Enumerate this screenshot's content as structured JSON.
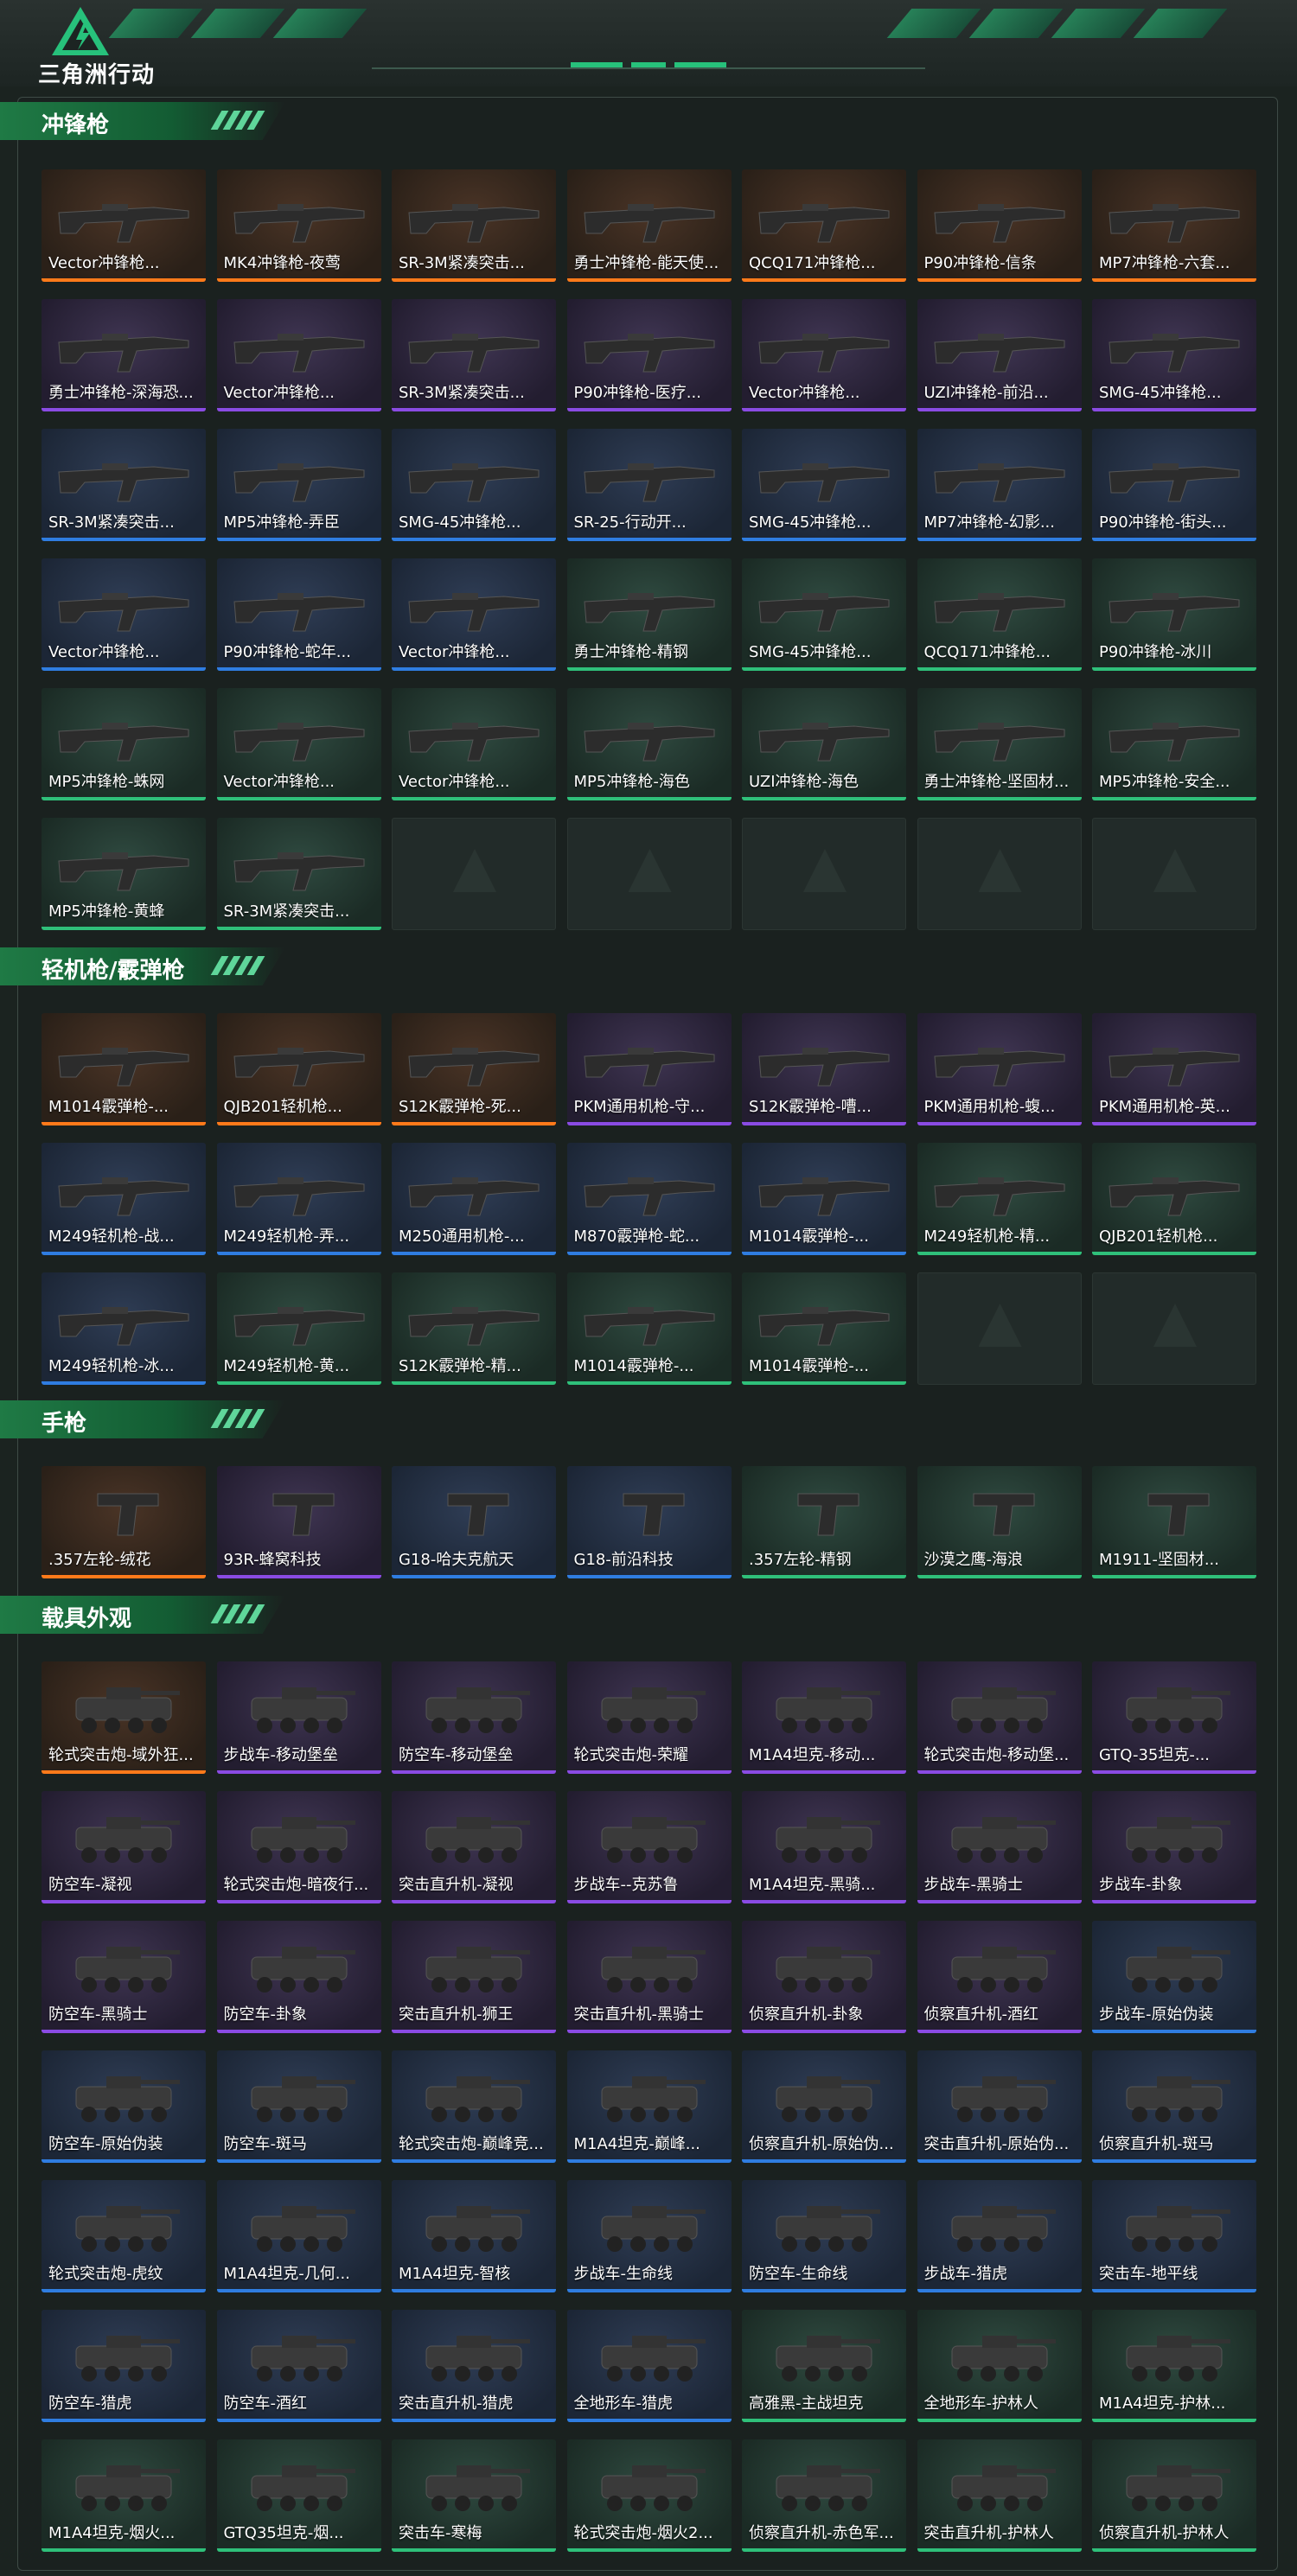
{
  "brand": {
    "name": "三角洲行动"
  },
  "colors": {
    "orange": "#ff7a1a",
    "purple": "#8a4be3",
    "blue": "#2f7de1",
    "green": "#2fc07a",
    "accent": "#27c17b"
  },
  "sections": [
    {
      "title": "冲锋枪",
      "kind": "gun",
      "items": [
        {
          "label": "Vector冲锋枪...",
          "rarity": "orange"
        },
        {
          "label": "MK4冲锋枪-夜莺",
          "rarity": "orange"
        },
        {
          "label": "SR-3M紧凑突击...",
          "rarity": "orange"
        },
        {
          "label": "勇士冲锋枪-能天使...",
          "rarity": "orange"
        },
        {
          "label": "QCQ171冲锋枪...",
          "rarity": "orange"
        },
        {
          "label": "P90冲锋枪-信条",
          "rarity": "orange"
        },
        {
          "label": "MP7冲锋枪-六套...",
          "rarity": "orange"
        },
        {
          "label": "勇士冲锋枪-深海恐...",
          "rarity": "purple"
        },
        {
          "label": "Vector冲锋枪...",
          "rarity": "purple"
        },
        {
          "label": "SR-3M紧凑突击...",
          "rarity": "purple"
        },
        {
          "label": "P90冲锋枪-医疗...",
          "rarity": "purple"
        },
        {
          "label": "Vector冲锋枪...",
          "rarity": "purple"
        },
        {
          "label": "UZI冲锋枪-前沿...",
          "rarity": "purple"
        },
        {
          "label": "SMG-45冲锋枪...",
          "rarity": "purple"
        },
        {
          "label": "SR-3M紧凑突击...",
          "rarity": "blue"
        },
        {
          "label": "MP5冲锋枪-弄臣",
          "rarity": "blue"
        },
        {
          "label": "SMG-45冲锋枪...",
          "rarity": "blue"
        },
        {
          "label": "SR-25-行动开...",
          "rarity": "blue"
        },
        {
          "label": "SMG-45冲锋枪...",
          "rarity": "blue"
        },
        {
          "label": "MP7冲锋枪-幻影...",
          "rarity": "blue"
        },
        {
          "label": "P90冲锋枪-街头...",
          "rarity": "blue"
        },
        {
          "label": "Vector冲锋枪...",
          "rarity": "blue"
        },
        {
          "label": "P90冲锋枪-蛇年...",
          "rarity": "blue"
        },
        {
          "label": "Vector冲锋枪...",
          "rarity": "blue"
        },
        {
          "label": "勇士冲锋枪-精钢",
          "rarity": "green"
        },
        {
          "label": "SMG-45冲锋枪...",
          "rarity": "green"
        },
        {
          "label": "QCQ171冲锋枪...",
          "rarity": "green"
        },
        {
          "label": "P90冲锋枪-冰川",
          "rarity": "green"
        },
        {
          "label": "MP5冲锋枪-蛛网",
          "rarity": "green"
        },
        {
          "label": "Vector冲锋枪...",
          "rarity": "green"
        },
        {
          "label": "Vector冲锋枪...",
          "rarity": "green"
        },
        {
          "label": "MP5冲锋枪-海色",
          "rarity": "green"
        },
        {
          "label": "UZI冲锋枪-海色",
          "rarity": "green"
        },
        {
          "label": "勇士冲锋枪-坚固材...",
          "rarity": "green"
        },
        {
          "label": "MP5冲锋枪-安全...",
          "rarity": "green"
        },
        {
          "label": "MP5冲锋枪-黄蜂",
          "rarity": "green"
        },
        {
          "label": "SR-3M紧凑突击...",
          "rarity": "green"
        },
        {
          "label": "",
          "rarity": "empty"
        },
        {
          "label": "",
          "rarity": "empty"
        },
        {
          "label": "",
          "rarity": "empty"
        },
        {
          "label": "",
          "rarity": "empty"
        },
        {
          "label": "",
          "rarity": "empty"
        }
      ]
    },
    {
      "title": "轻机枪/霰弹枪",
      "kind": "gun",
      "items": [
        {
          "label": "M1014霰弹枪-...",
          "rarity": "orange"
        },
        {
          "label": "QJB201轻机枪...",
          "rarity": "orange"
        },
        {
          "label": "S12K霰弹枪-死...",
          "rarity": "orange"
        },
        {
          "label": "PKM通用机枪-守...",
          "rarity": "purple"
        },
        {
          "label": "S12K霰弹枪-嘈...",
          "rarity": "purple"
        },
        {
          "label": "PKM通用机枪-蝮...",
          "rarity": "purple"
        },
        {
          "label": "PKM通用机枪-英...",
          "rarity": "purple"
        },
        {
          "label": "M249轻机枪-战...",
          "rarity": "blue"
        },
        {
          "label": "M249轻机枪-弄...",
          "rarity": "blue"
        },
        {
          "label": "M250通用机枪-...",
          "rarity": "blue"
        },
        {
          "label": "M870霰弹枪-蛇...",
          "rarity": "blue"
        },
        {
          "label": "M1014霰弹枪-...",
          "rarity": "blue"
        },
        {
          "label": "M249轻机枪-精...",
          "rarity": "green"
        },
        {
          "label": "QJB201轻机枪...",
          "rarity": "green"
        },
        {
          "label": "M249轻机枪-冰...",
          "rarity": "blue"
        },
        {
          "label": "M249轻机枪-黄...",
          "rarity": "green"
        },
        {
          "label": "S12K霰弹枪-精...",
          "rarity": "green"
        },
        {
          "label": "M1014霰弹枪-...",
          "rarity": "green"
        },
        {
          "label": "M1014霰弹枪-...",
          "rarity": "green"
        },
        {
          "label": "",
          "rarity": "empty"
        },
        {
          "label": "",
          "rarity": "empty"
        }
      ]
    },
    {
      "title": "手枪",
      "kind": "pistol",
      "items": [
        {
          "label": ".357左轮-绒花",
          "rarity": "orange"
        },
        {
          "label": "93R-蜂窝科技",
          "rarity": "purple"
        },
        {
          "label": "G18-哈夫克航天",
          "rarity": "blue"
        },
        {
          "label": "G18-前沿科技",
          "rarity": "blue"
        },
        {
          "label": ".357左轮-精钢",
          "rarity": "green"
        },
        {
          "label": "沙漠之鹰-海浪",
          "rarity": "green"
        },
        {
          "label": "M1911-坚固材...",
          "rarity": "green"
        }
      ]
    },
    {
      "title": "载具外观",
      "kind": "vehicle",
      "items": [
        {
          "label": "轮式突击炮-域外狂...",
          "rarity": "orange"
        },
        {
          "label": "步战车-移动堡垒",
          "rarity": "purple"
        },
        {
          "label": "防空车-移动堡垒",
          "rarity": "purple"
        },
        {
          "label": "轮式突击炮-荣耀",
          "rarity": "purple"
        },
        {
          "label": "M1A4坦克-移动...",
          "rarity": "purple"
        },
        {
          "label": "轮式突击炮-移动堡...",
          "rarity": "purple"
        },
        {
          "label": "GTQ-35坦克-...",
          "rarity": "purple"
        },
        {
          "label": "防空车-凝视",
          "rarity": "purple"
        },
        {
          "label": "轮式突击炮-暗夜行...",
          "rarity": "purple"
        },
        {
          "label": "突击直升机-凝视",
          "rarity": "purple"
        },
        {
          "label": "步战车--克苏鲁",
          "rarity": "purple"
        },
        {
          "label": "M1A4坦克-黑骑...",
          "rarity": "purple"
        },
        {
          "label": "步战车-黑骑士",
          "rarity": "purple"
        },
        {
          "label": "步战车-卦象",
          "rarity": "purple"
        },
        {
          "label": "防空车-黑骑士",
          "rarity": "purple"
        },
        {
          "label": "防空车-卦象",
          "rarity": "purple"
        },
        {
          "label": "突击直升机-狮王",
          "rarity": "purple"
        },
        {
          "label": "突击直升机-黑骑士",
          "rarity": "purple"
        },
        {
          "label": "侦察直升机-卦象",
          "rarity": "purple"
        },
        {
          "label": "侦察直升机-酒红",
          "rarity": "purple"
        },
        {
          "label": "步战车-原始伪装",
          "rarity": "blue"
        },
        {
          "label": "防空车-原始伪装",
          "rarity": "blue"
        },
        {
          "label": "防空车-斑马",
          "rarity": "blue"
        },
        {
          "label": "轮式突击炮-巅峰竞...",
          "rarity": "blue"
        },
        {
          "label": "M1A4坦克-巅峰...",
          "rarity": "blue"
        },
        {
          "label": "侦察直升机-原始伪...",
          "rarity": "blue"
        },
        {
          "label": "突击直升机-原始伪...",
          "rarity": "blue"
        },
        {
          "label": "侦察直升机-斑马",
          "rarity": "blue"
        },
        {
          "label": "轮式突击炮-虎纹",
          "rarity": "blue"
        },
        {
          "label": "M1A4坦克-几何...",
          "rarity": "blue"
        },
        {
          "label": "M1A4坦克-智核",
          "rarity": "blue"
        },
        {
          "label": "步战车-生命线",
          "rarity": "blue"
        },
        {
          "label": "防空车-生命线",
          "rarity": "blue"
        },
        {
          "label": "步战车-猎虎",
          "rarity": "blue"
        },
        {
          "label": "突击车-地平线",
          "rarity": "blue"
        },
        {
          "label": "防空车-猎虎",
          "rarity": "blue"
        },
        {
          "label": "防空车-酒红",
          "rarity": "blue"
        },
        {
          "label": "突击直升机-猎虎",
          "rarity": "blue"
        },
        {
          "label": "全地形车-猎虎",
          "rarity": "blue"
        },
        {
          "label": "高雅黑-主战坦克",
          "rarity": "green"
        },
        {
          "label": "全地形车-护林人",
          "rarity": "green"
        },
        {
          "label": "M1A4坦克-护林...",
          "rarity": "green"
        },
        {
          "label": "M1A4坦克-烟火...",
          "rarity": "green"
        },
        {
          "label": "GTQ35坦克-烟...",
          "rarity": "green"
        },
        {
          "label": "突击车-寒梅",
          "rarity": "green"
        },
        {
          "label": "轮式突击炮-烟火2...",
          "rarity": "green"
        },
        {
          "label": "侦察直升机-赤色军...",
          "rarity": "green"
        },
        {
          "label": "突击直升机-护林人",
          "rarity": "green"
        },
        {
          "label": "侦察直升机-护林人",
          "rarity": "green"
        }
      ]
    }
  ]
}
